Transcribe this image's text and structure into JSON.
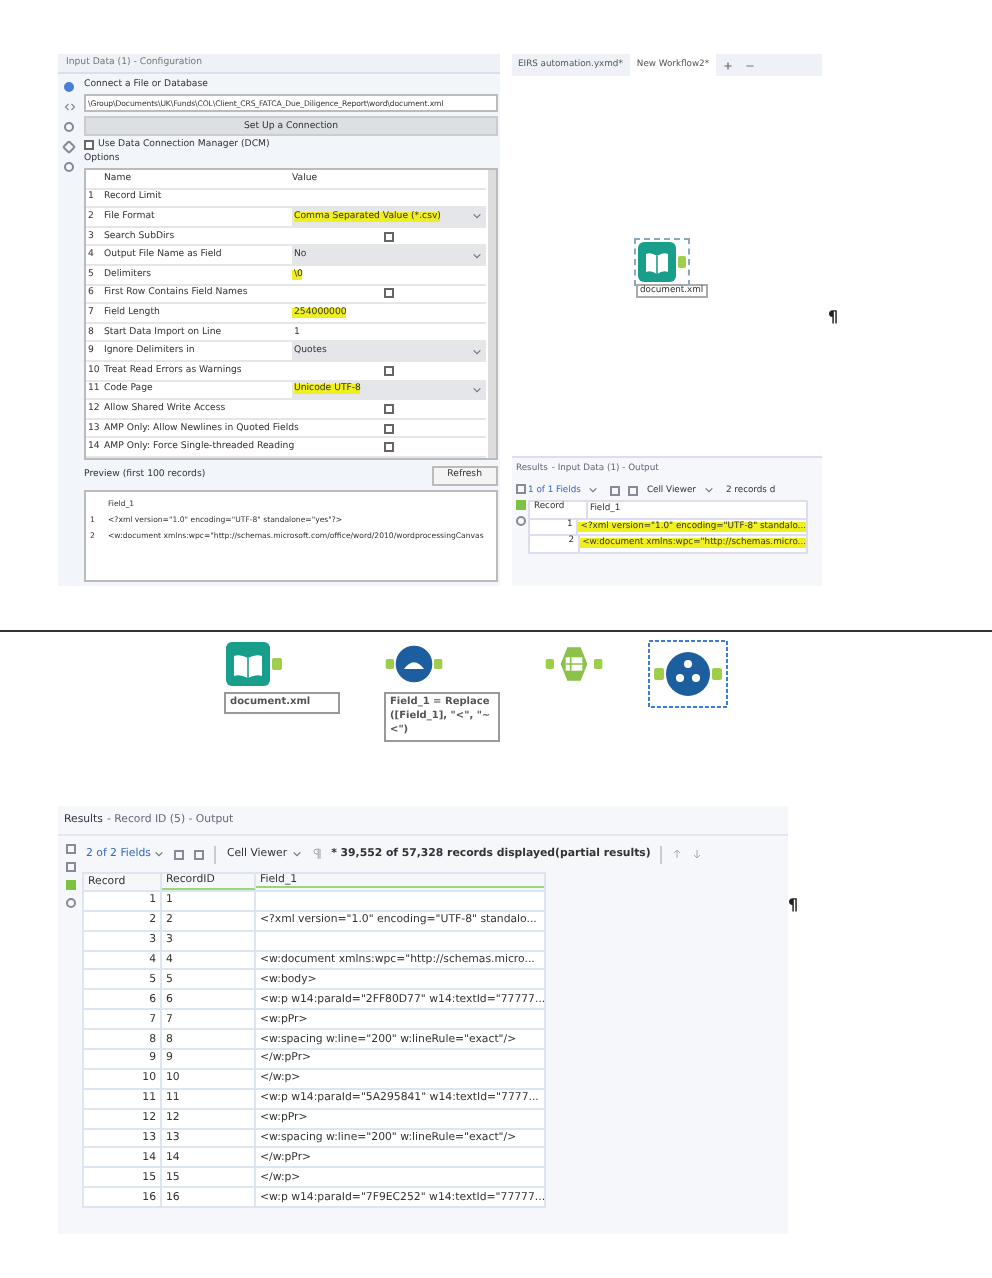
{
  "config_panel": {
    "title": "Input Data (1) - Configuration",
    "connect_label": "Connect a File or Database",
    "path": "\\Group\\Documents\\UK\\Funds\\COL\\Client_CRS_FATCA_Due_Diligence_Report\\word\\document.xml",
    "setup_button": "Set Up a Connection",
    "dcm": {
      "label": "Use Data Connection Manager (DCM)",
      "checked": false
    },
    "options_label": "Options",
    "columns": [
      "Name",
      "Value"
    ],
    "options": [
      {
        "index": "1",
        "name": "Record Limit",
        "kind": "text"
      },
      {
        "index": "2",
        "name": "File Format",
        "kind": "dropdown",
        "value": "Comma Separated Value (*.csv)",
        "highlighted": true
      },
      {
        "index": "3",
        "name": "Search SubDirs",
        "kind": "checkbox",
        "checked": false
      },
      {
        "index": "4",
        "name": "Output File Name as Field",
        "kind": "dropdown",
        "value": "No",
        "highlighted": false
      },
      {
        "index": "5",
        "name": "Delimiters",
        "kind": "text",
        "value": "\\0",
        "highlighted": true
      },
      {
        "index": "6",
        "name": "First Row Contains Field Names",
        "kind": "checkbox",
        "checked": false
      },
      {
        "index": "7",
        "name": "Field Length",
        "kind": "text",
        "value": "254000000",
        "highlighted": true
      },
      {
        "index": "8",
        "name": "Start Data Import on Line",
        "kind": "text",
        "value": "1",
        "highlighted": false
      },
      {
        "index": "9",
        "name": "Ignore Delimiters in",
        "kind": "dropdown",
        "value": "Quotes",
        "highlighted": false
      },
      {
        "index": "10",
        "name": "Treat Read Errors as Warnings",
        "kind": "checkbox",
        "checked": false
      },
      {
        "index": "11",
        "name": "Code Page",
        "kind": "dropdown",
        "value": "Unicode UTF-8",
        "highlighted": true
      },
      {
        "index": "12",
        "name": "Allow Shared Write Access",
        "kind": "checkbox",
        "checked": false
      },
      {
        "index": "13",
        "name": "AMP Only: Allow Newlines in Quoted Fields",
        "kind": "checkbox",
        "checked": false
      },
      {
        "index": "14",
        "name": "AMP Only: Force Single-threaded Reading",
        "kind": "checkbox",
        "checked": false
      }
    ],
    "preview": {
      "label": "Preview (first 100 records)",
      "refresh_button": "Refresh",
      "column": "Field_1",
      "rows": [
        {
          "index": "1",
          "value": "<?xml version=\"1.0\" encoding=\"UTF-8\" standalone=\"yes\"?>"
        },
        {
          "index": "2",
          "value": "<w:document xmlns:wpc=\"http://schemas.microsoft.com/office/word/2010/wordprocessingCanvas"
        }
      ]
    }
  },
  "workflow_tabs": [
    {
      "label": "EIRS automation.yxmd*",
      "selected": false
    },
    {
      "label": "New Workflow2*",
      "selected": true
    }
  ],
  "canvas": {
    "node_label": "document.xml"
  },
  "mini_results": {
    "title": "Results",
    "subtitle": "- Input Data (1) - Output",
    "fields": "1 of 1 Fields",
    "viewer": "Cell Viewer",
    "count": "2 records d",
    "columns": [
      "Record",
      "Field_1"
    ],
    "rows": [
      {
        "record": "1",
        "value": "<?xml version=\"1.0\" encoding=\"UTF-8\" standalo...",
        "highlighted": true
      },
      {
        "record": "2",
        "value": "<w:document xmlns:wpc=\"http://schemas.micro...",
        "highlighted": true
      }
    ]
  },
  "pilcrows": [
    "¶",
    "¶"
  ],
  "workflow_strip": {
    "nodes": [
      {
        "kind": "input",
        "label": "document.xml"
      },
      {
        "kind": "formula",
        "label": "Field_1 = Replace ([Field_1], \"<\", \"~<\")"
      },
      {
        "kind": "text-to-columns"
      },
      {
        "kind": "record-id"
      }
    ]
  },
  "results": {
    "title": "Results",
    "subtitle": "- Record ID (5) - Output",
    "fields": "2 of 2 Fields",
    "viewer": "Cell Viewer",
    "count": "* 39,552 of 57,328 records displayed(partial results)",
    "columns": [
      "Record",
      "RecordID",
      "Field_1"
    ],
    "rows": [
      {
        "record": "1",
        "id": "1",
        "value": ""
      },
      {
        "record": "2",
        "id": "2",
        "value": "<?xml version=\"1.0\" encoding=\"UTF-8\" standalo..."
      },
      {
        "record": "3",
        "id": "3",
        "value": ""
      },
      {
        "record": "4",
        "id": "4",
        "value": "<w:document xmlns:wpc=\"http://schemas.micro..."
      },
      {
        "record": "5",
        "id": "5",
        "value": "<w:body>"
      },
      {
        "record": "6",
        "id": "6",
        "value": "<w:p w14:paraId=\"2FF80D77\" w14:textId=\"77777..."
      },
      {
        "record": "7",
        "id": "7",
        "value": "<w:pPr>"
      },
      {
        "record": "8",
        "id": "8",
        "value": "<w:spacing w:line=\"200\" w:lineRule=\"exact\"/>"
      },
      {
        "record": "9",
        "id": "9",
        "value": "</w:pPr>"
      },
      {
        "record": "10",
        "id": "10",
        "value": "</w:p>"
      },
      {
        "record": "11",
        "id": "11",
        "value": "<w:p w14:paraId=\"5A295841\" w14:textId=\"7777..."
      },
      {
        "record": "12",
        "id": "12",
        "value": "<w:pPr>"
      },
      {
        "record": "13",
        "id": "13",
        "value": "<w:spacing w:line=\"200\" w:lineRule=\"exact\"/>"
      },
      {
        "record": "14",
        "id": "14",
        "value": "</w:pPr>"
      },
      {
        "record": "15",
        "id": "15",
        "value": "</w:p>"
      },
      {
        "record": "16",
        "id": "16",
        "value": "<w:p w14:paraId=\"7F9EC252\" w14:textId=\"77777..."
      }
    ]
  }
}
